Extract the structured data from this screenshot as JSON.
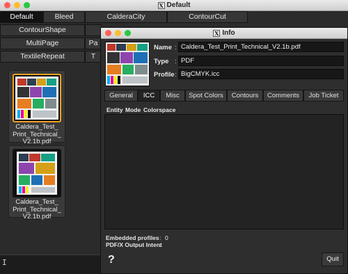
{
  "main_window": {
    "title": "Default",
    "tabs_row1": [
      "Default",
      "Bleed",
      "CalderaCity",
      "ContourCut"
    ],
    "tabs_row2": [
      "ContourShape",
      ""
    ],
    "tabs_row3": [
      "MultiPage",
      "Pa"
    ],
    "tabs_row4": [
      "TextileRepeat",
      "T"
    ],
    "files": [
      {
        "caption": "Caldera_Test_\nPrint_Technical_\nV2.1b.pdf",
        "selected": true
      },
      {
        "caption": "Caldera_Test_\nPrint_Technical_\nV2.1b.pdf",
        "selected": false
      }
    ],
    "status_cursor": "I"
  },
  "info_dialog": {
    "title": "Info",
    "fields": {
      "name_label": "Name",
      "name_value": "Caldera_Test_Print_Technical_V2.1b.pdf",
      "type_label": "Type",
      "type_value": "PDF",
      "profile_label": "Profile",
      "profile_value": "BigCMYK.icc",
      "colon": ":"
    },
    "tabs": [
      "General",
      "ICC",
      "Misc",
      "Spot Colors",
      "Contours",
      "Comments",
      "Job Ticket"
    ],
    "active_tab": "ICC",
    "columns": [
      "Entity",
      "Mode",
      "Colorspace"
    ],
    "embedded_profiles_label": "Embedded profiles",
    "embedded_profiles_value": "0",
    "output_intent_label": "PDF/X Output Intent",
    "help_label": "?",
    "quit_label": "Quit"
  },
  "colors": {
    "accent_selection": "#f0a020",
    "close_dot": "#ff5f57",
    "min_dot": "#febc2e",
    "max_dot": "#28c840"
  }
}
